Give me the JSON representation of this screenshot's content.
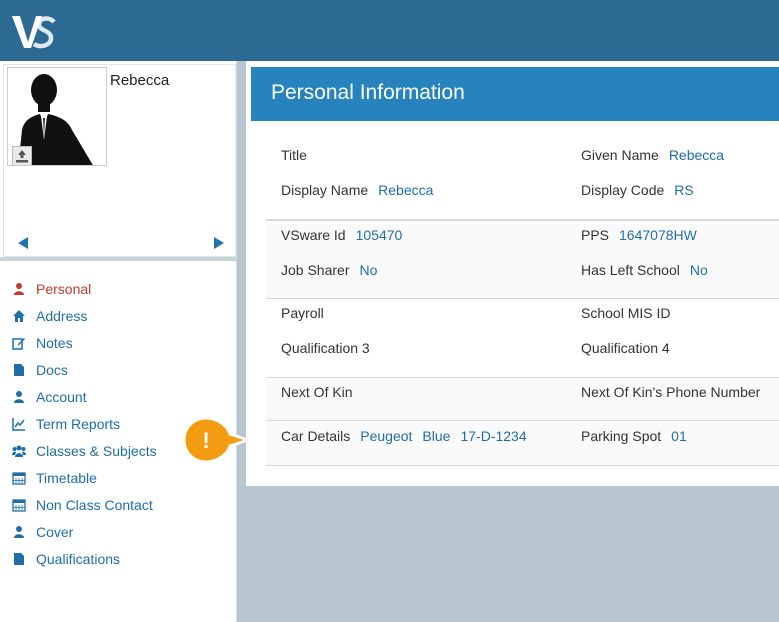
{
  "brand": {
    "logo_text": "VS"
  },
  "profile": {
    "name": "Rebecca"
  },
  "sidebar": {
    "items": [
      {
        "label": "Personal",
        "icon": "user-icon",
        "active": true
      },
      {
        "label": "Address",
        "icon": "home-icon"
      },
      {
        "label": "Notes",
        "icon": "edit-icon"
      },
      {
        "label": "Docs",
        "icon": "document-icon"
      },
      {
        "label": "Account",
        "icon": "user-icon"
      },
      {
        "label": "Term Reports",
        "icon": "line-chart-icon"
      },
      {
        "label": "Classes & Subjects",
        "icon": "group-icon"
      },
      {
        "label": "Timetable",
        "icon": "calendar-icon"
      },
      {
        "label": "Non Class Contact",
        "icon": "calendar-icon"
      },
      {
        "label": "Cover",
        "icon": "user-icon"
      },
      {
        "label": "Qualifications",
        "icon": "document-icon"
      }
    ]
  },
  "card": {
    "title": "Personal Information",
    "fields": {
      "title_label": "Title",
      "given_name_label": "Given Name",
      "given_name_value": "Rebecca",
      "display_name_label": "Display Name",
      "display_name_value": "Rebecca",
      "display_code_label": "Display Code",
      "display_code_value": "RS",
      "vsware_id_label": "VSware Id",
      "vsware_id_value": "105470",
      "pps_label": "PPS",
      "pps_value": "1647078HW",
      "job_sharer_label": "Job Sharer",
      "job_sharer_value": "No",
      "has_left_label": "Has Left School",
      "has_left_value": "No",
      "payroll_label": "Payroll",
      "school_mis_label": "School MIS ID",
      "qual3_label": "Qualification 3",
      "qual4_label": "Qualification 4",
      "next_of_kin_label": "Next Of Kin",
      "next_of_kin_phone_label": "Next Of Kin's Phone Number",
      "car_details_label": "Car Details",
      "car_make": "Peugeot",
      "car_colour": "Blue",
      "car_reg": "17-D-1234",
      "parking_spot_label": "Parking Spot",
      "parking_spot_value": "01"
    }
  },
  "alert": {
    "symbol": "!",
    "color": "#f39c12"
  }
}
